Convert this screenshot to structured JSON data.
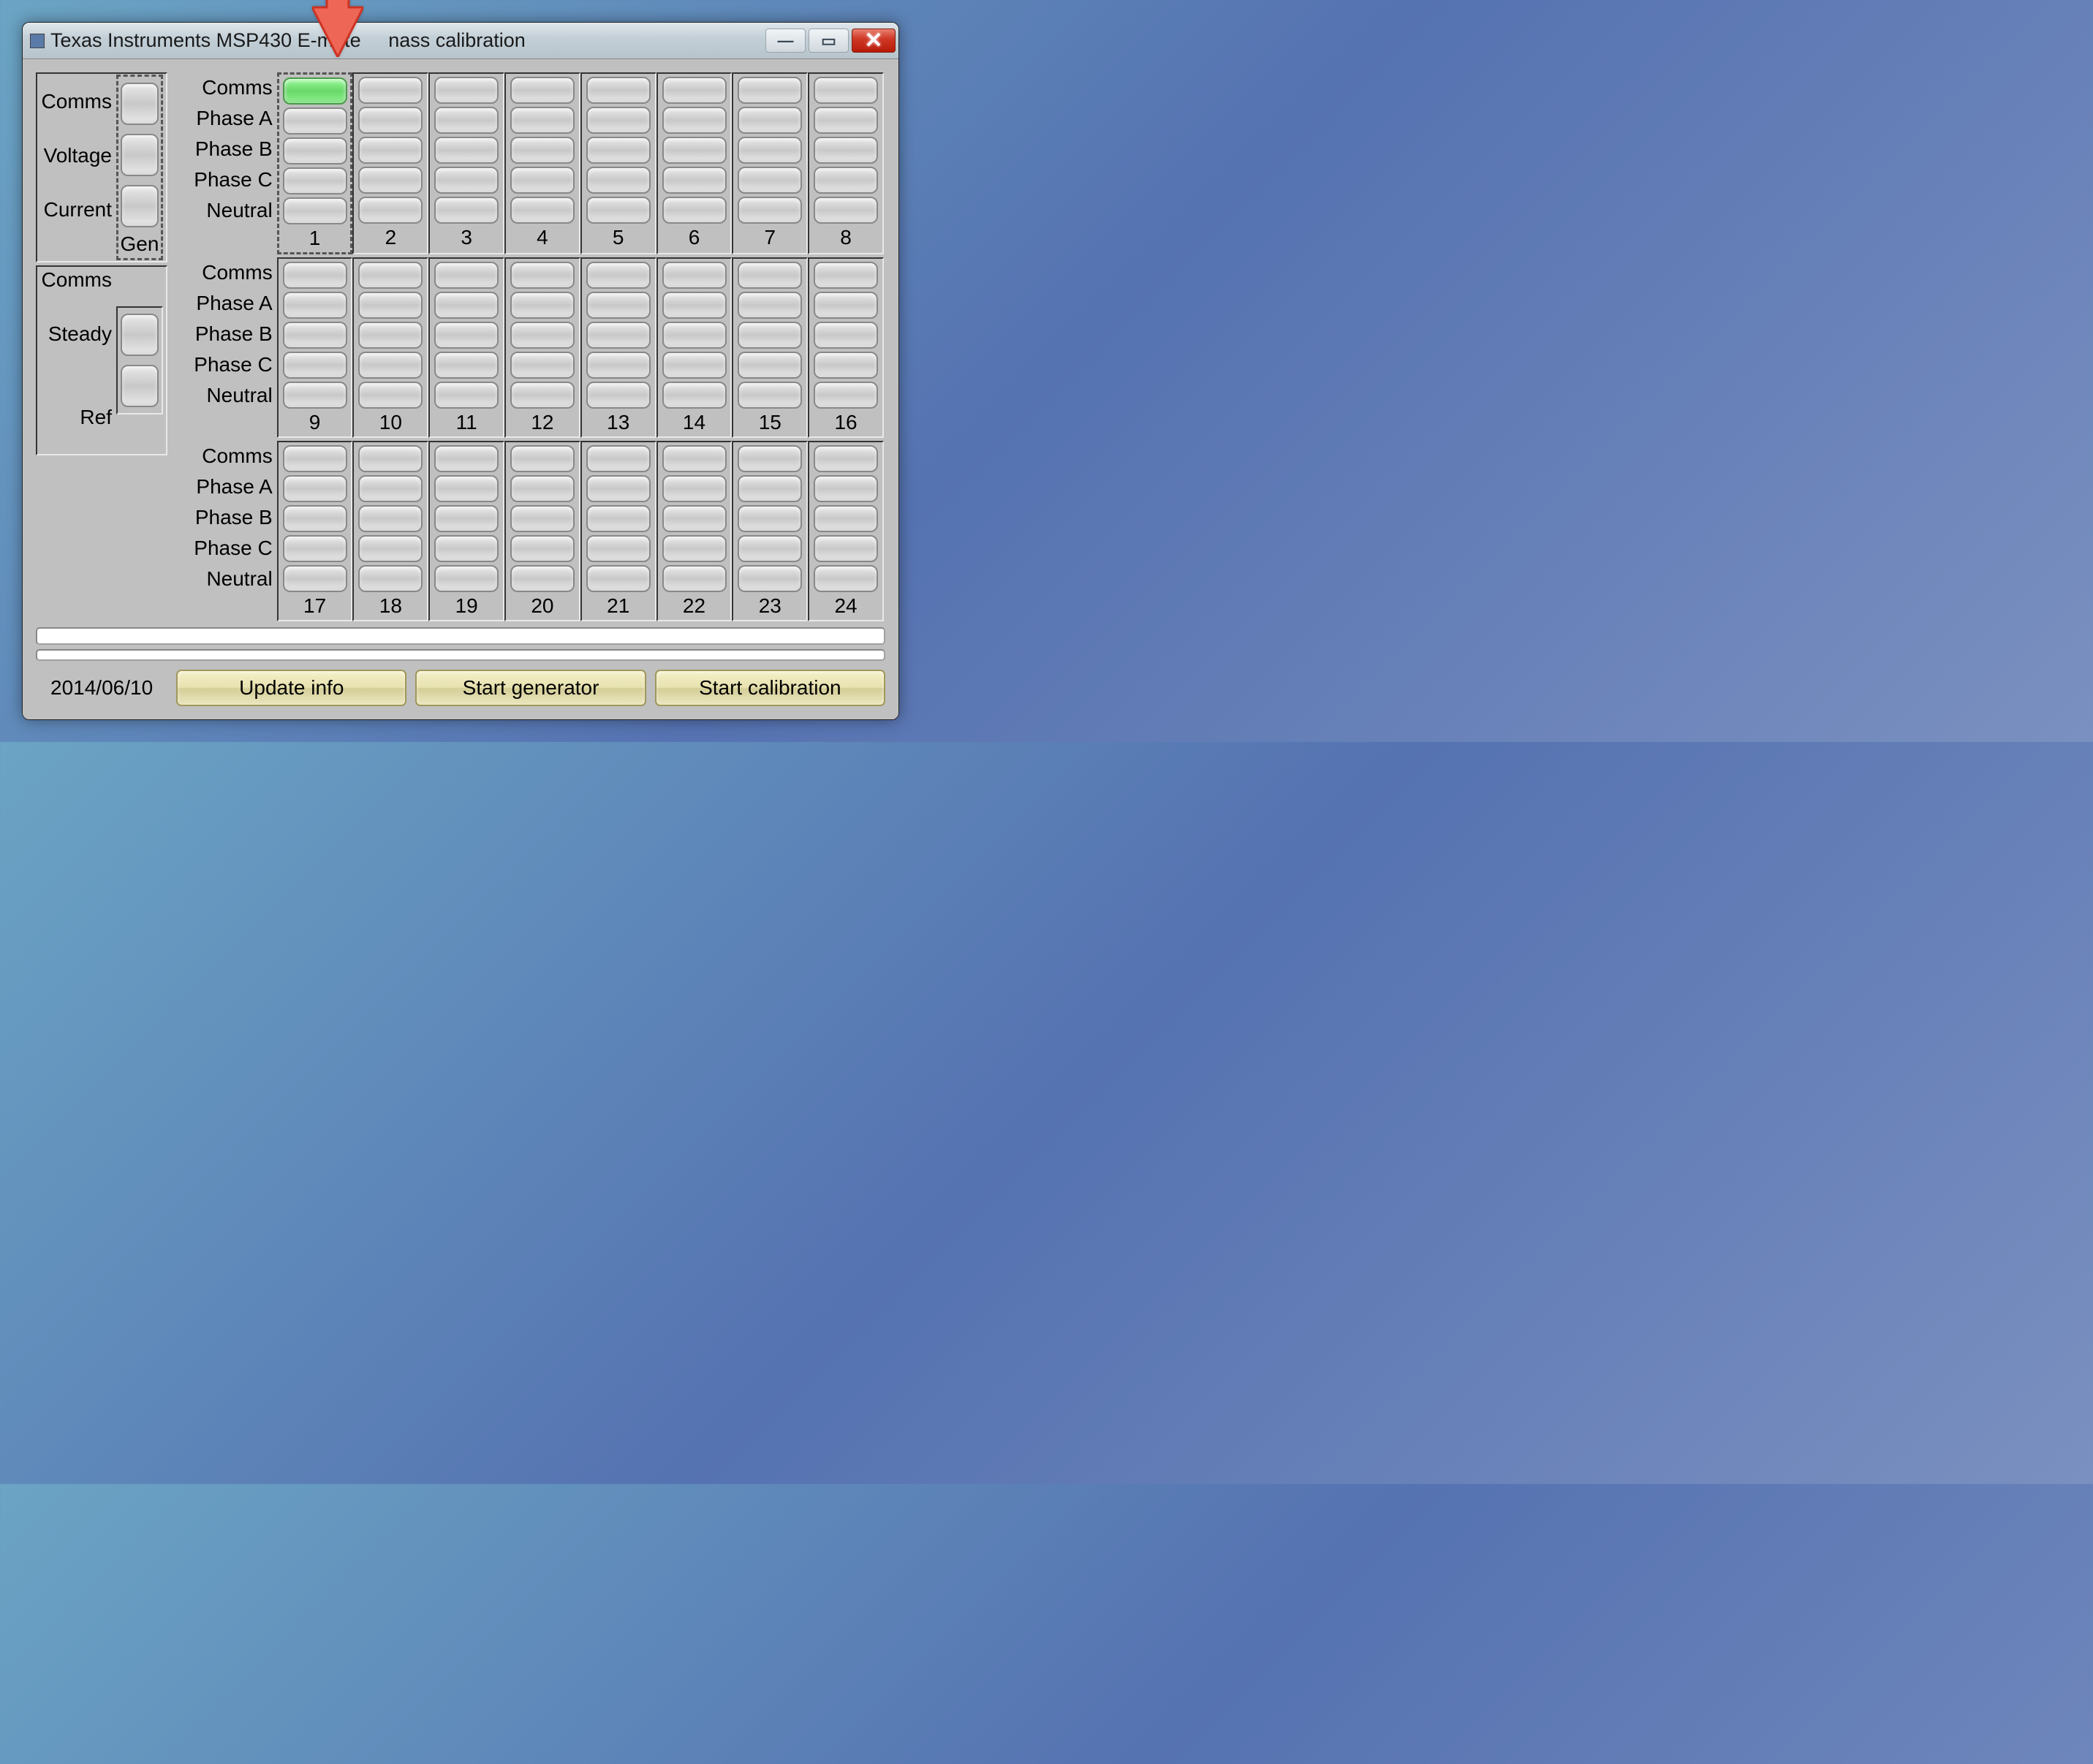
{
  "title": "Texas Instruments MSP430 E-meter mass calibration",
  "title_display_a": "Texas Instruments MSP430 E-mete",
  "title_display_b": "nass calibration",
  "left": {
    "gen": {
      "labels": [
        "Comms",
        "Voltage",
        "Current"
      ],
      "footer": "Gen"
    },
    "ref": {
      "labels": [
        "Comms",
        "Steady"
      ],
      "footer": "Ref"
    }
  },
  "phase_labels": [
    "Comms",
    "Phase A",
    "Phase B",
    "Phase C",
    "Neutral"
  ],
  "banks": [
    {
      "columns": [
        1,
        2,
        3,
        4,
        5,
        6,
        7,
        8
      ],
      "highlight_col": 1,
      "green_at": {
        "col": 1,
        "row": 0
      }
    },
    {
      "columns": [
        9,
        10,
        11,
        12,
        13,
        14,
        15,
        16
      ]
    },
    {
      "columns": [
        17,
        18,
        19,
        20,
        21,
        22,
        23,
        24
      ]
    }
  ],
  "date": "2014/06/10",
  "buttons": {
    "update": "Update info",
    "start_gen": "Start generator",
    "start_cal": "Start calibration"
  }
}
